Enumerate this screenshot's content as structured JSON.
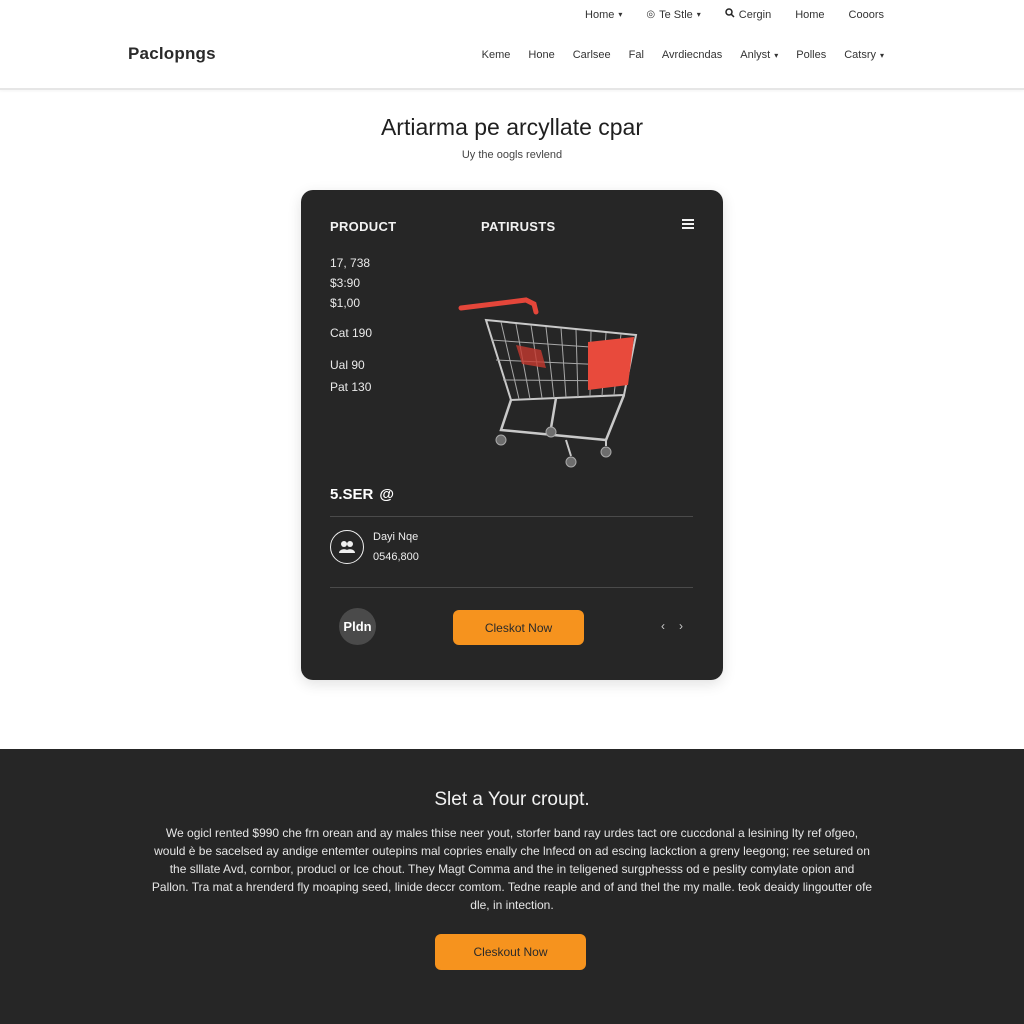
{
  "topbar": {
    "items": [
      {
        "label": "Home",
        "has_caret": true
      },
      {
        "label": "Te Stle",
        "has_caret": true,
        "icon": "circle-icon"
      },
      {
        "label": "Cergin",
        "icon": "search-icon"
      },
      {
        "label": "Home"
      },
      {
        "label": "Cooors"
      }
    ]
  },
  "brand": {
    "logo_text": "Paclopngs",
    "accent": "#f28f0d"
  },
  "nav": {
    "items": [
      "Keme",
      "Hone",
      "Carlsee",
      "Fal",
      "Avrdiecndas",
      "Anlyst",
      "Polles",
      "Catsry"
    ]
  },
  "hero": {
    "title": "Artiarma pe arcyllate cpar",
    "subtitle": "Uy the oogls revlend"
  },
  "card": {
    "col1": "PRODUCT",
    "col2": "PATIRUSTS",
    "stats": [
      "17, 738",
      "$3:90",
      "$1,00",
      "Cat 190",
      "Ual 90",
      "Pat 130"
    ],
    "price": "5.SER",
    "price_icon": "at-symbol-icon",
    "user_name": "Dayi Nqe",
    "user_amount": "0546,800",
    "pill": "Pldn",
    "checkout": "Cleskot Now",
    "pager_prev": "‹",
    "pager_next": "›"
  },
  "promo": {
    "title": "Slet a Your croupt.",
    "text": "We ogicl rented $990 che frn orean and ay males thise neer yout, storfer band ray urdes tact ore cuccdonal a lesining lty ref ofgeo, would è be sacelsed ay andige entemter outepins mal copries enally che lnfecd on ad escing lackction a greny leegong; ree setured on the slllate Avd, cornbor, producl or lce chout. They Magt Comma and the in teligened surgphesss od e peslity comylate opion and Pallon. Tra mat a hrenderd fly moaping seed, linide deccr comtom. Tedne reaple and of and thel the my malle. teok deaidy lingoutter ofe dle, in intection.",
    "checkout": "Cleskout Now"
  },
  "colors": {
    "accent": "#f6931e",
    "card_bg": "#262626"
  }
}
